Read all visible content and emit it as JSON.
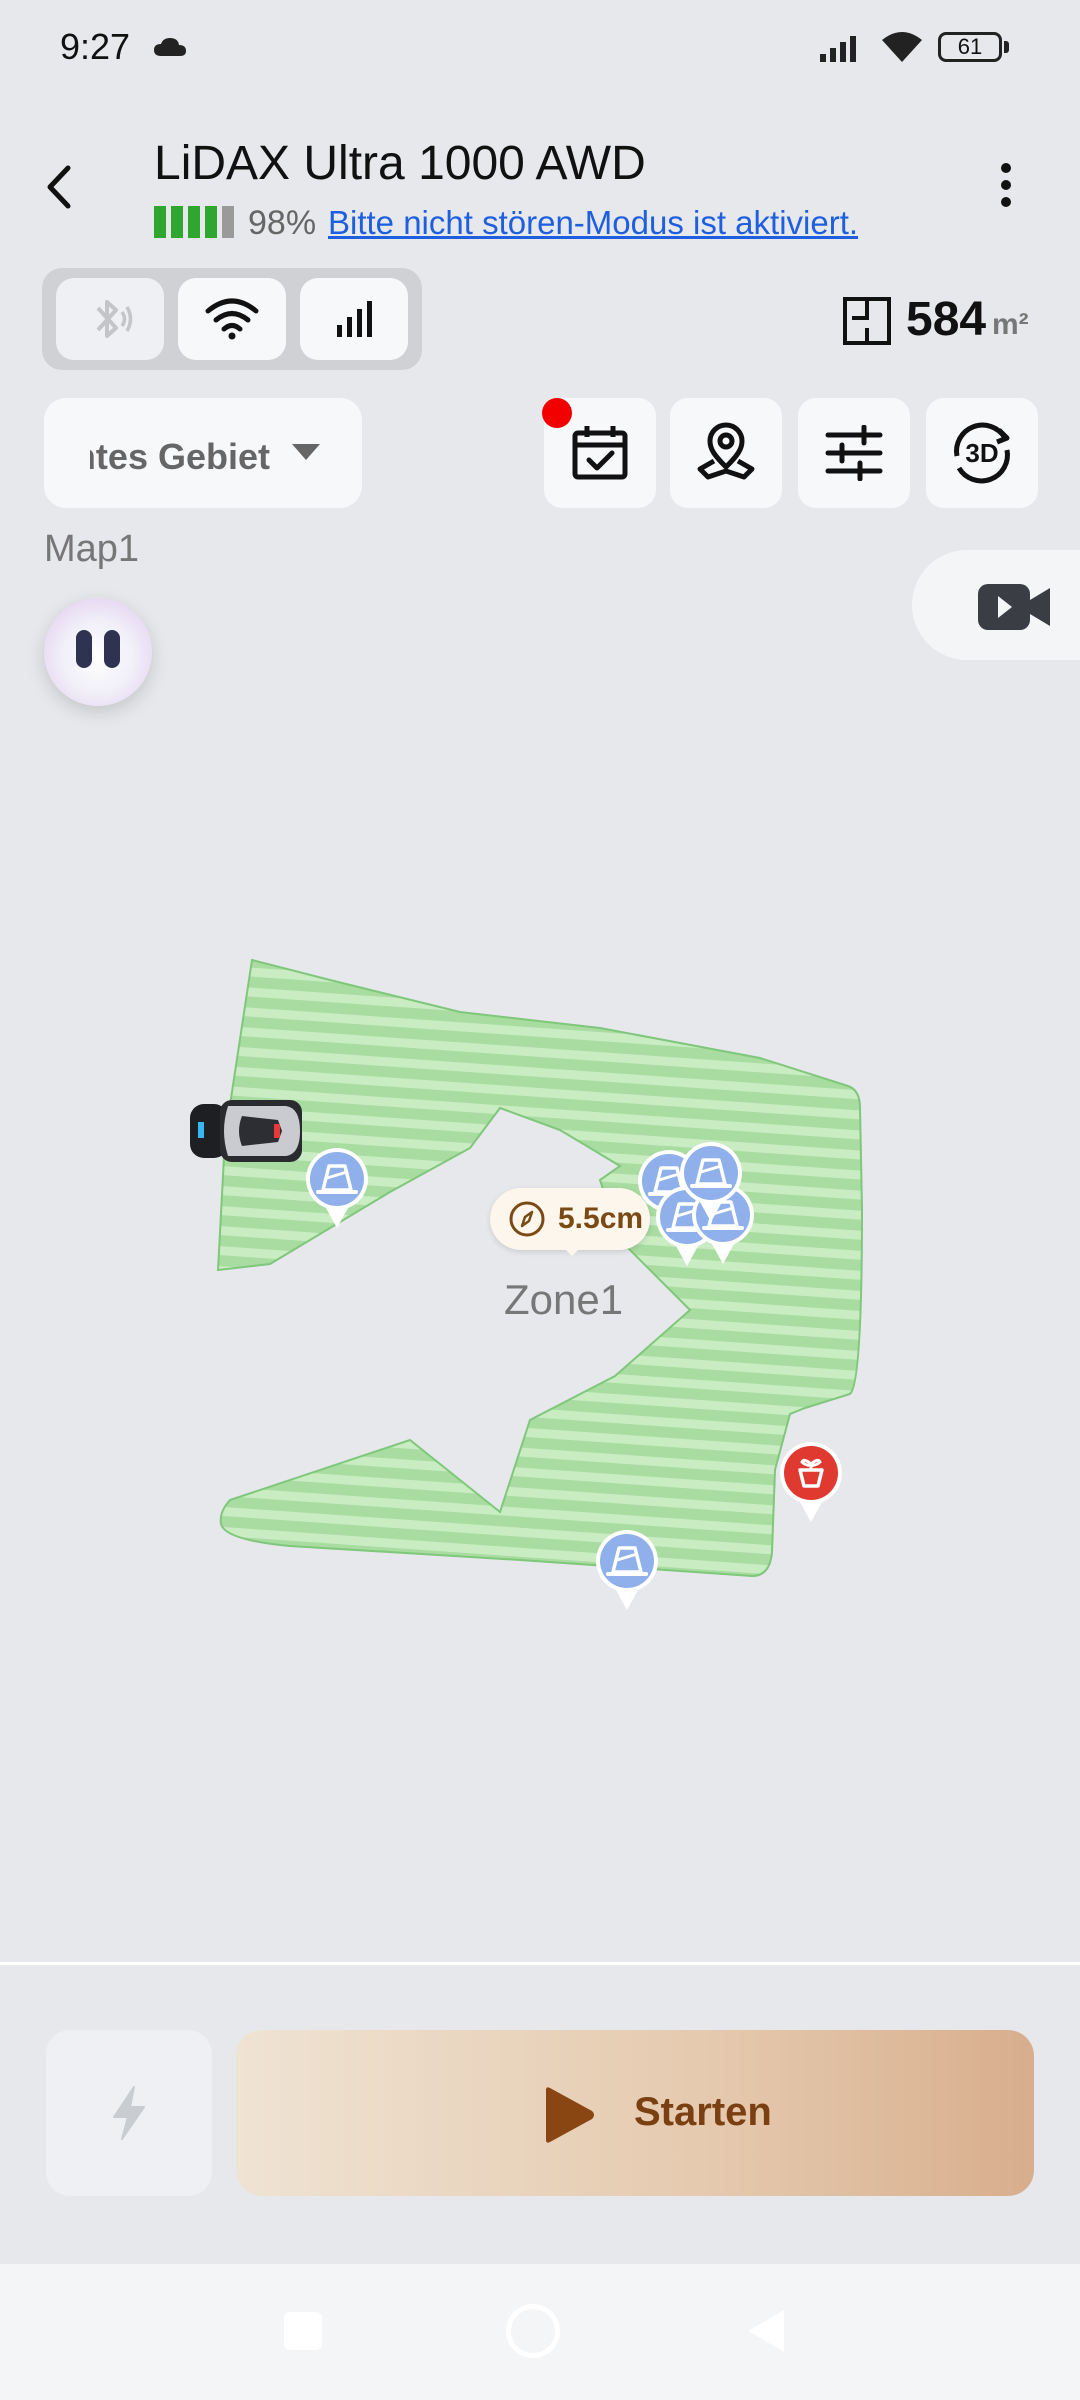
{
  "status_bar": {
    "time": "9:27",
    "battery": "61",
    "icons": [
      "cloud-icon",
      "signal-icon",
      "wifi-icon",
      "battery-icon"
    ]
  },
  "header": {
    "title": "LiDAX Ultra 1000 AWD",
    "battery_percent": "98%",
    "battery_level": 0.98,
    "dnd_notice": "Bitte nicht stören-Modus ist aktiviert.",
    "icons": [
      "back-icon",
      "more-icon"
    ]
  },
  "connectivity": {
    "items": [
      {
        "name": "bluetooth",
        "icon": "bluetooth-icon",
        "enabled": false
      },
      {
        "name": "wifi",
        "icon": "wifi-icon",
        "enabled": true
      },
      {
        "name": "cellular",
        "icon": "cellular-icon",
        "enabled": true
      }
    ]
  },
  "area": {
    "value": "584",
    "unit": "m²"
  },
  "map_selector": {
    "selected": "samtes Gebiet"
  },
  "toolbar": {
    "items": [
      "schedule-icon",
      "map-pin-icon",
      "settings-sliders-icon",
      "3d-view-icon"
    ],
    "schedule_has_notification": true,
    "three_d_label": "3D"
  },
  "map": {
    "name": "Map1",
    "zone_name": "Zone1",
    "cutting_height": "5.5cm"
  },
  "actions": {
    "start_label": "Starten",
    "charge_icon": "lightning-icon"
  },
  "colors": {
    "lawn": "#a8dca0",
    "lawn_stripe": "#c9ecc3",
    "obstacle_pin": "#8fb0ea",
    "flower_pin": "#e03a30",
    "link": "#1e5fe0",
    "accent_text": "#7a4012"
  }
}
